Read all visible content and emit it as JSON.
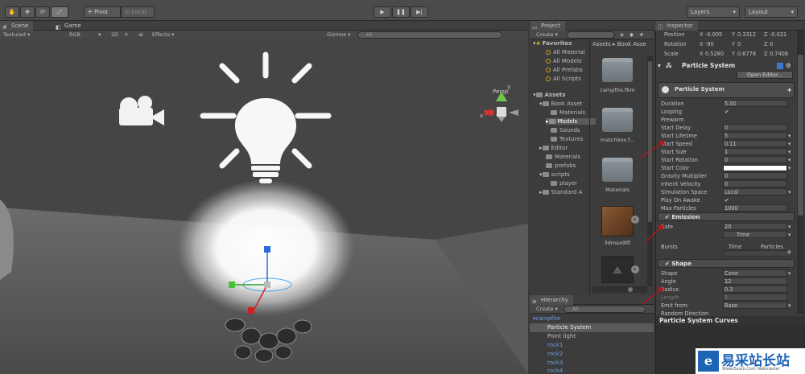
{
  "toolbar": {
    "tools": [
      "hand-icon",
      "move-icon",
      "rotate-icon",
      "scale-icon"
    ],
    "pivot": "Pivot",
    "local": "Local",
    "layers": "Layers",
    "layout": "Layout"
  },
  "scene": {
    "tab_scene": "Scene",
    "tab_game": "Game",
    "render_mode": "Textured",
    "color_mode": "RGB",
    "mode_2d": "2D",
    "effects": "Effects",
    "gizmos": "Gizmos",
    "search": "All",
    "persp": "Persp",
    "gizmo_labels": {
      "x": "x",
      "y": "y"
    }
  },
  "project": {
    "tab": "Project",
    "create": "Create",
    "favorites_header": "Favorites",
    "favorites": [
      "All Material",
      "All Models",
      "All Prefabs",
      "All Scripts"
    ],
    "assets_header": "Assets",
    "tree": [
      {
        "label": "Book Asset",
        "level": 1
      },
      {
        "label": "Materials",
        "level": 2
      },
      {
        "label": "Models",
        "level": 2,
        "selected": true
      },
      {
        "label": "Sounds",
        "level": 2
      },
      {
        "label": "Textures",
        "level": 2
      },
      {
        "label": "Editor",
        "level": 1
      },
      {
        "label": "Materials",
        "level": 1
      },
      {
        "label": "prefabs",
        "level": 1
      },
      {
        "label": "scripts",
        "level": 1
      },
      {
        "label": "player",
        "level": 2
      },
      {
        "label": "Standard A",
        "level": 1
      }
    ],
    "breadcrumb": [
      "Assets",
      "Book Asse"
    ],
    "assets": [
      "campfire.fbm",
      "matchbox.f...",
      "Materials",
      "3dmax9lft",
      ""
    ]
  },
  "hierarchy": {
    "tab": "Hierarchy",
    "create": "Create",
    "search": "All",
    "root": "campfire",
    "items": [
      "Particle System",
      "Point light",
      "rock1",
      "rock2",
      "rock3",
      "rock4"
    ]
  },
  "inspector": {
    "tab": "Inspector",
    "transform": {
      "position_label": "Position",
      "px": "-0.005",
      "py": "0.3312",
      "pz": "-0.021",
      "rotation_label": "Rotation",
      "rx": "-90",
      "ry": "0",
      "rz": "0",
      "scale_label": "Scale",
      "sx": "0.5280",
      "sy": "0.6778",
      "sz": "0.7406"
    },
    "component_title": "Particle System",
    "open_editor": "Open Editor...",
    "module_title": "Particle System",
    "props": [
      {
        "label": "Duration",
        "value": "5.00"
      },
      {
        "label": "Looping",
        "value": "✔"
      },
      {
        "label": "Prewarm",
        "value": ""
      },
      {
        "label": "Start Delay",
        "value": "0"
      },
      {
        "label": "Start Lifetime",
        "value": "5"
      },
      {
        "label": "Start Speed",
        "value": "0.11"
      },
      {
        "label": "Start Size",
        "value": "1"
      },
      {
        "label": "Start Rotation",
        "value": "0"
      },
      {
        "label": "Start Color",
        "value": ""
      },
      {
        "label": "Gravity Multiplier",
        "value": "0"
      },
      {
        "label": "Inherit Velocity",
        "value": "0"
      },
      {
        "label": "Simulation Space",
        "value": "Local"
      },
      {
        "label": "Play On Awake",
        "value": "✔"
      },
      {
        "label": "Max Particles",
        "value": "1000"
      }
    ],
    "emission_title": "Emission",
    "rate_label": "Rate",
    "rate_value": "20",
    "rate_mode": "Time",
    "bursts_label": "Bursts",
    "bursts_time": "Time",
    "bursts_particles": "Particles",
    "shape_title": "Shape",
    "shape_props": [
      {
        "label": "Shape",
        "value": "Cone"
      },
      {
        "label": "Angle",
        "value": "12"
      },
      {
        "label": "Radius",
        "value": "0.3"
      },
      {
        "label": "Length",
        "value": "5"
      },
      {
        "label": "Emit from:",
        "value": "Base"
      },
      {
        "label": "Random Direction",
        "value": ""
      }
    ],
    "curves_title": "Particle System Curves"
  },
  "watermark": {
    "cn": "易采站长站",
    "en": "Www.Easck.Com Webmaster"
  },
  "colors": {
    "accent": "#2a67b8",
    "selection": "#3d6ea8",
    "red_marker": "#c0141b"
  }
}
